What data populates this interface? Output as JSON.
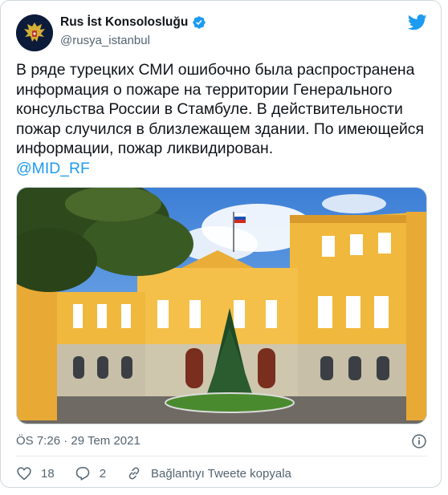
{
  "user": {
    "name": "Rus İst Konsolosluğu",
    "handle": "@rusya_istanbul",
    "avatar_icon": "russian-eagle-emblem",
    "verified_icon": "verified-badge-icon"
  },
  "tweet": {
    "text": "В ряде турецких СМИ ошибочно была распространена информация о пожаре на территории Генерального консульства России в Стамбуле. В действительности пожар случился в близлежащем здании.  По имеющейся информации, пожар ликвидирован.",
    "mention": "@MID_RF",
    "timestamp": "ÖS 7:26 · 29 Tem 2021"
  },
  "actions": {
    "likes": "18",
    "replies": "2",
    "copy_link": "Bağlantıyı Tweete kopyala"
  },
  "colors": {
    "accent": "#1d9bf0",
    "text_primary": "#0f1419",
    "text_secondary": "#536471",
    "building": "#f0b83c"
  }
}
